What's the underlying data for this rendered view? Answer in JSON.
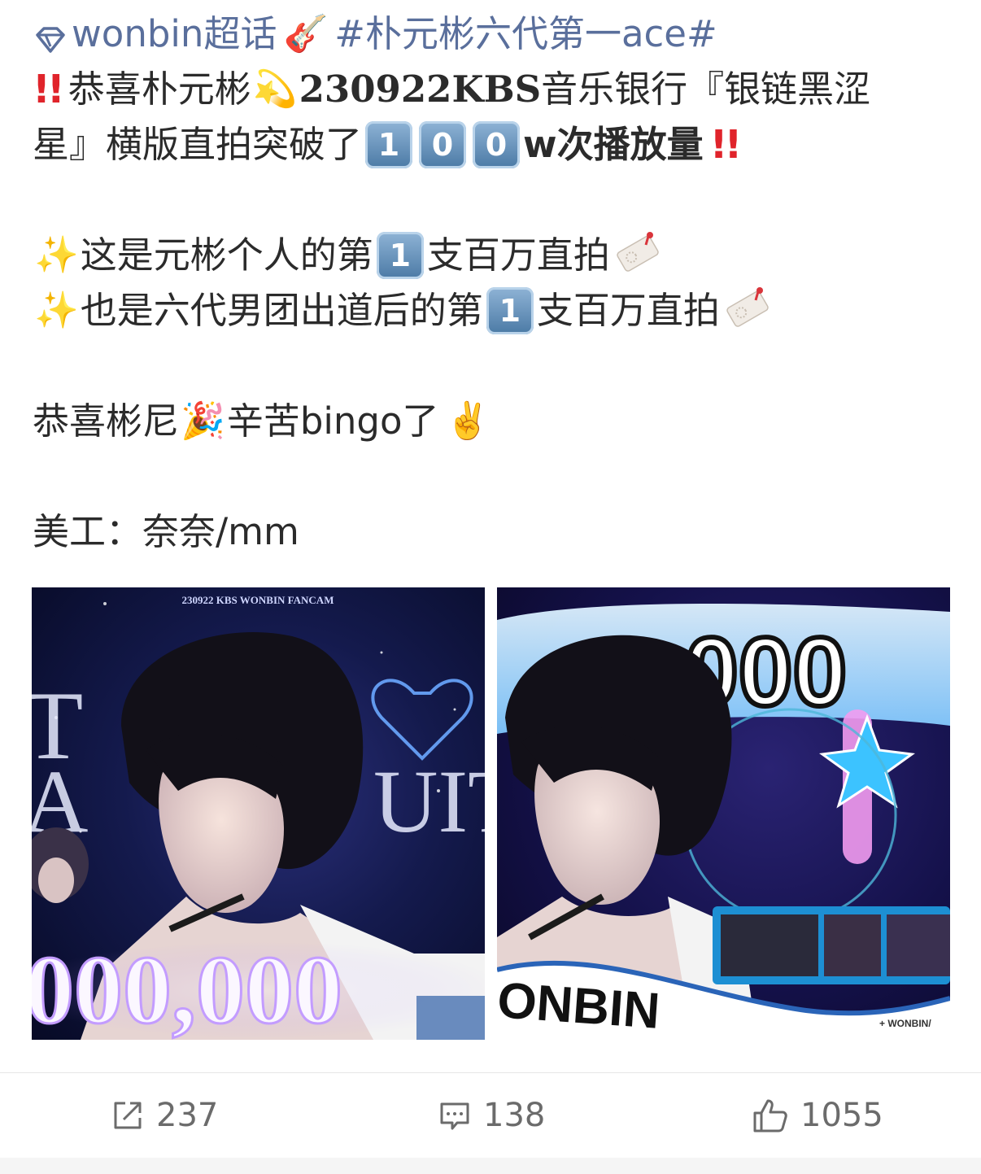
{
  "post": {
    "line1": {
      "topic": "wonbin超话",
      "hashtag": "#朴元彬六代第一ace#"
    },
    "line2": {
      "text_a": "恭喜朴元彬",
      "text_bold": "230922KBS",
      "text_b": "音乐银行『银链黑涩"
    },
    "line3": {
      "text_a": "星』横版直拍突破了",
      "keycaps": [
        "1",
        "0",
        "0"
      ],
      "text_b": "w次播放量"
    },
    "line4": {
      "text_a": "这是元彬个人的第",
      "keycap": "1",
      "text_b": "支百万直拍"
    },
    "line5": {
      "text_a": "也是六代男团出道后的第",
      "keycap": "1",
      "text_b": "支百万直拍"
    },
    "line6": {
      "text_a": "恭喜彬尼",
      "text_b": " 辛苦bingo了"
    },
    "line7": {
      "text": "美工：奈奈/mm"
    }
  },
  "images": {
    "left": {
      "header": "230922 KBS WONBIN FANCAM",
      "big_number": "000,000"
    },
    "right": {
      "big_number": "000",
      "name": "ONBIN",
      "watermark": "+ WONBIN/"
    }
  },
  "actions": {
    "repost_count": "237",
    "comment_count": "138",
    "like_count": "1055"
  },
  "colors": {
    "link": "#5a6f9c",
    "alert": "#e0242b",
    "keycap": "#4b7aa5"
  }
}
